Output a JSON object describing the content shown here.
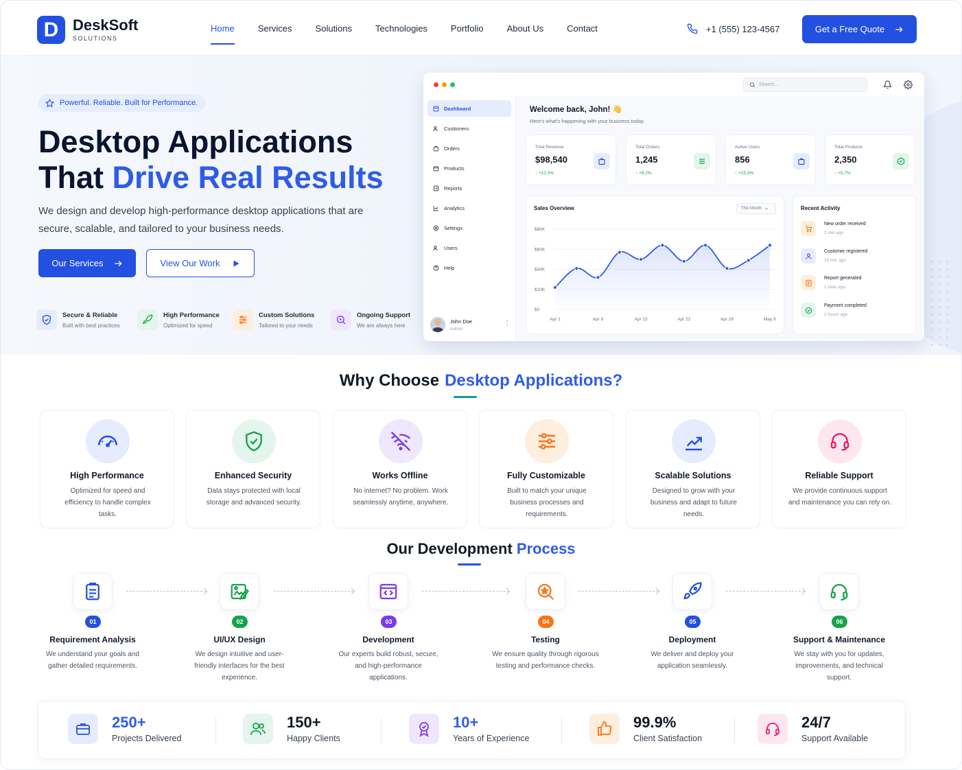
{
  "brand": {
    "name": "DeskSoft",
    "sub": "SOLUTIONS",
    "mark": "D"
  },
  "nav": {
    "items": [
      "Home",
      "Services",
      "Solutions",
      "Technologies",
      "Portfolio",
      "About Us",
      "Contact"
    ],
    "phone": "+1 (555) 123-4567",
    "cta": "Get a Free Quote"
  },
  "hero": {
    "pill": "Powerful. Reliable. Built for Performance.",
    "title_line1": "Desktop Applications",
    "title_line2_a": "That ",
    "title_line2_b": "Drive Real Results",
    "lead": "We design and develop high-performance desktop applications that are secure, scalable, and tailored to your business needs.",
    "btn_primary": "Our Services",
    "btn_secondary": "View Our Work",
    "features": [
      {
        "title": "Secure & Reliable",
        "sub": "Built with best practices",
        "icon": "shield-check-icon"
      },
      {
        "title": "High Performance",
        "sub": "Optimized for speed",
        "icon": "rocket-icon"
      },
      {
        "title": "Custom Solutions",
        "sub": "Tailored to your needs",
        "icon": "sliders-icon"
      },
      {
        "title": "Ongoing Support",
        "sub": "We are always here",
        "icon": "support-search-icon"
      }
    ]
  },
  "dashboard": {
    "search_placeholder": "Search...",
    "sidebar": [
      "Dashboard",
      "Customers",
      "Orders",
      "Products",
      "Reports",
      "Analytics",
      "Settings",
      "Users",
      "Help"
    ],
    "user": {
      "name": "John Doe",
      "role": "Admin"
    },
    "welcome": "Welcome back, John! 👋",
    "welcome_sub": "Here's what's happening with your business today.",
    "kpis": [
      {
        "label": "Total Revenue",
        "value": "$98,540",
        "change": "+12.5%"
      },
      {
        "label": "Total Orders",
        "value": "1,245",
        "change": "+8.2%"
      },
      {
        "label": "Active Users",
        "value": "856",
        "change": "+15.3%"
      },
      {
        "label": "Total Products",
        "value": "2,350",
        "change": "+5.7%"
      }
    ],
    "sales": {
      "title": "Sales Overview",
      "period": "This Month",
      "y_ticks": [
        "$80K",
        "$60K",
        "$40K",
        "$20K",
        "$0"
      ],
      "x_ticks": [
        "Apr 1",
        "Apr 8",
        "Apr 15",
        "Apr 22",
        "Apr 29",
        "May 6"
      ]
    },
    "recent": {
      "title": "Recent Activity",
      "items": [
        {
          "title": "New order received",
          "time": "2 min ago"
        },
        {
          "title": "Customer registered",
          "time": "15 min ago"
        },
        {
          "title": "Report generated",
          "time": "1 hour ago"
        },
        {
          "title": "Payment completed",
          "time": "2 hours ago"
        }
      ]
    }
  },
  "chart_data": {
    "type": "line",
    "title": "Sales Overview",
    "x": [
      "Apr 1",
      "Apr 4",
      "Apr 8",
      "Apr 11",
      "Apr 15",
      "Apr 19",
      "Apr 22",
      "Apr 26",
      "Apr 29",
      "May 3",
      "May 6"
    ],
    "y": [
      22000,
      41000,
      32000,
      57000,
      50000,
      64000,
      48000,
      64000,
      41000,
      49000,
      64000
    ],
    "y_unit": "$",
    "ylim": [
      0,
      80000
    ],
    "y_tick_labels": [
      "$0",
      "$20K",
      "$40K",
      "$60K",
      "$80K"
    ],
    "x_tick_labels": [
      "Apr 1",
      "Apr 8",
      "Apr 15",
      "Apr 22",
      "Apr 29",
      "May 6"
    ],
    "grid": true
  },
  "why": {
    "title_a": "Why Choose",
    "title_b": "Desktop Applications?",
    "cards": [
      {
        "title": "High Performance",
        "desc": "Optimized for speed and efficiency to handle complex tasks.",
        "icon": "speedometer-icon"
      },
      {
        "title": "Enhanced Security",
        "desc": "Data stays protected with local storage and advanced security.",
        "icon": "shield-check-icon"
      },
      {
        "title": "Works Offline",
        "desc": "No internet? No problem. Work seamlessly anytime, anywhere.",
        "icon": "wifi-off-icon"
      },
      {
        "title": "Fully Customizable",
        "desc": "Built to match your unique business processes and requirements.",
        "icon": "sliders-icon"
      },
      {
        "title": "Scalable Solutions",
        "desc": "Designed to grow with your business and adapt to future needs.",
        "icon": "growth-chart-icon"
      },
      {
        "title": "Reliable Support",
        "desc": "We provide continuous support and maintenance you can rely on.",
        "icon": "headset-icon"
      }
    ]
  },
  "process": {
    "title_a": "Our Development ",
    "title_b": "Process",
    "steps": [
      {
        "num": "01",
        "title": "Requirement Analysis",
        "desc": "We understand your goals and gather detailed requirements.",
        "icon": "clipboard-icon"
      },
      {
        "num": "02",
        "title": "UI/UX Design",
        "desc": "We design intuitive and user-friendly interfaces for the best experience.",
        "icon": "design-icon"
      },
      {
        "num": "03",
        "title": "Development",
        "desc": "Our experts build robust, secure, and high-performance applications.",
        "icon": "code-window-icon"
      },
      {
        "num": "04",
        "title": "Testing",
        "desc": "We ensure quality through rigorous testing and performance checks.",
        "icon": "magnifier-bug-icon"
      },
      {
        "num": "05",
        "title": "Deployment",
        "desc": "We deliver and deploy your application seamlessly.",
        "icon": "rocket-icon"
      },
      {
        "num": "06",
        "title": "Support & Maintenance",
        "desc": "We stay with you for updates, improvements, and technical support.",
        "icon": "headset-icon"
      }
    ]
  },
  "stats": [
    {
      "value": "250+",
      "label": "Projects Delivered",
      "icon": "briefcase-icon"
    },
    {
      "value": "150+",
      "label": "Happy Clients",
      "icon": "users-icon"
    },
    {
      "value": "10+",
      "label": "Years of Experience",
      "icon": "award-icon"
    },
    {
      "value": "99.9%",
      "label": "Client Satisfaction",
      "icon": "thumbs-up-icon"
    },
    {
      "value": "24/7",
      "label": "Support Available",
      "icon": "headset-icon"
    }
  ],
  "colors": {
    "primary": "#2350e0",
    "accent_blue": "#2f5ce6",
    "green": "#16a34a",
    "purple": "#7c3aed",
    "orange": "#f97316",
    "pink": "#e11d6b",
    "teal": "#0f9d8a"
  }
}
